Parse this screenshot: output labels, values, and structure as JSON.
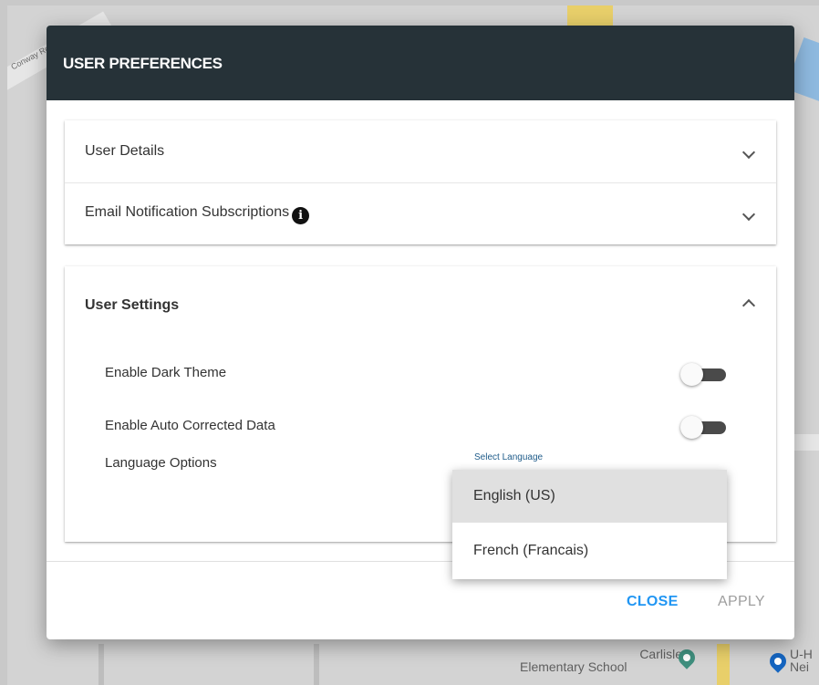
{
  "background_map": {
    "street_label": "Conway Rd",
    "place_label_line1": "Carlisle",
    "place_label_line2": "Elementary School",
    "poi_label_line1": "U-H",
    "poi_label_line2": "Nei",
    "colors": {
      "school_pin": "#3f8f7e",
      "poi_pin": "#1565c0"
    }
  },
  "dialog": {
    "title": "USER PREFERENCES",
    "header_color": "#263238",
    "sections": [
      {
        "label": "User Details",
        "expanded": false
      },
      {
        "label": "Email Notification Subscriptions",
        "expanded": false,
        "info_icon": "i"
      },
      {
        "label": "User Settings",
        "expanded": true
      }
    ],
    "user_settings": {
      "dark_theme_label": "Enable Dark Theme",
      "dark_theme_enabled": false,
      "auto_corrected_label": "Enable Auto Corrected Data",
      "auto_corrected_enabled": false,
      "language_label": "Language Options",
      "select_caption": "Select Language",
      "language_options": [
        "English (US)",
        "French (Francais)"
      ],
      "selected_language": "English (US)"
    },
    "buttons": {
      "close_label": "CLOSE",
      "apply_label": "APPLY",
      "close_color": "#2196f3",
      "apply_color": "#9e9e9e"
    }
  }
}
